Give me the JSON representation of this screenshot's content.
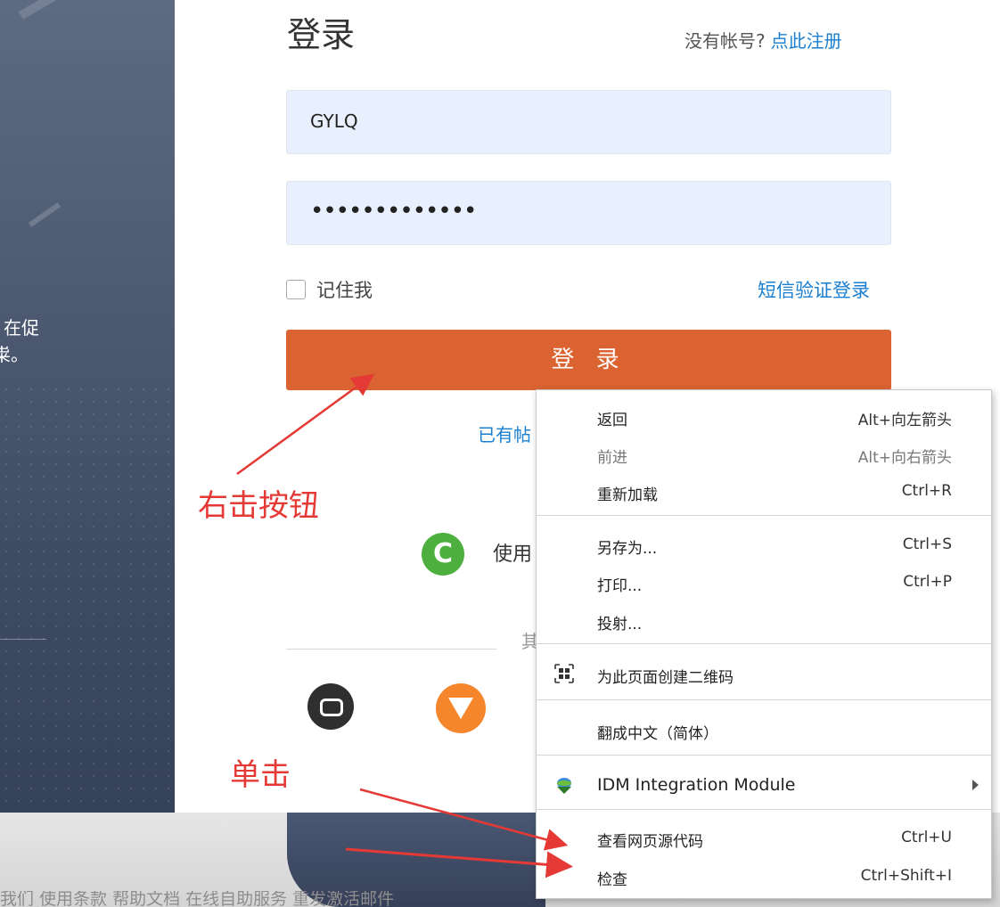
{
  "left_panel": {
    "text_line1": "在促",
    "text_line2": "粜。"
  },
  "login": {
    "title": "登录",
    "no_account_prompt": "没有帐号?",
    "register_link": "点此注册",
    "username_value": "GYLQ",
    "password_value": "•••••••••••••",
    "remember_label": "记住我",
    "sms_login_link": "短信验证登录",
    "login_button": "登 录",
    "have_account_partial": "已有帖",
    "use_partial": "使用",
    "other_partial": "其"
  },
  "footer": {
    "links_partial": "我们  使用条款  帮助文档  在线自助服务  重发激活邮件"
  },
  "annotations": {
    "right_click": "右击按钮",
    "click": "单击"
  },
  "context_menu": {
    "back": {
      "label": "返回",
      "shortcut": "Alt+向左箭头"
    },
    "forward": {
      "label": "前进",
      "shortcut": "Alt+向右箭头"
    },
    "reload": {
      "label": "重新加载",
      "shortcut": "Ctrl+R"
    },
    "save_as": {
      "label": "另存为...",
      "shortcut": "Ctrl+S"
    },
    "print": {
      "label": "打印...",
      "shortcut": "Ctrl+P"
    },
    "cast": {
      "label": "投射..."
    },
    "qr_code": {
      "label": "为此页面创建二维码",
      "icon": "qr-code-icon"
    },
    "translate": {
      "label": "翻成中文（简体）"
    },
    "idm": {
      "label": "IDM Integration Module",
      "icon": "idm-icon"
    },
    "view_source": {
      "label": "查看网页源代码",
      "shortcut": "Ctrl+U"
    },
    "inspect": {
      "label": "检查",
      "shortcut": "Ctrl+Shift+I"
    }
  },
  "colors": {
    "accent_button": "#db6332",
    "link": "#1a7fd0",
    "annotation": "#e53935"
  }
}
